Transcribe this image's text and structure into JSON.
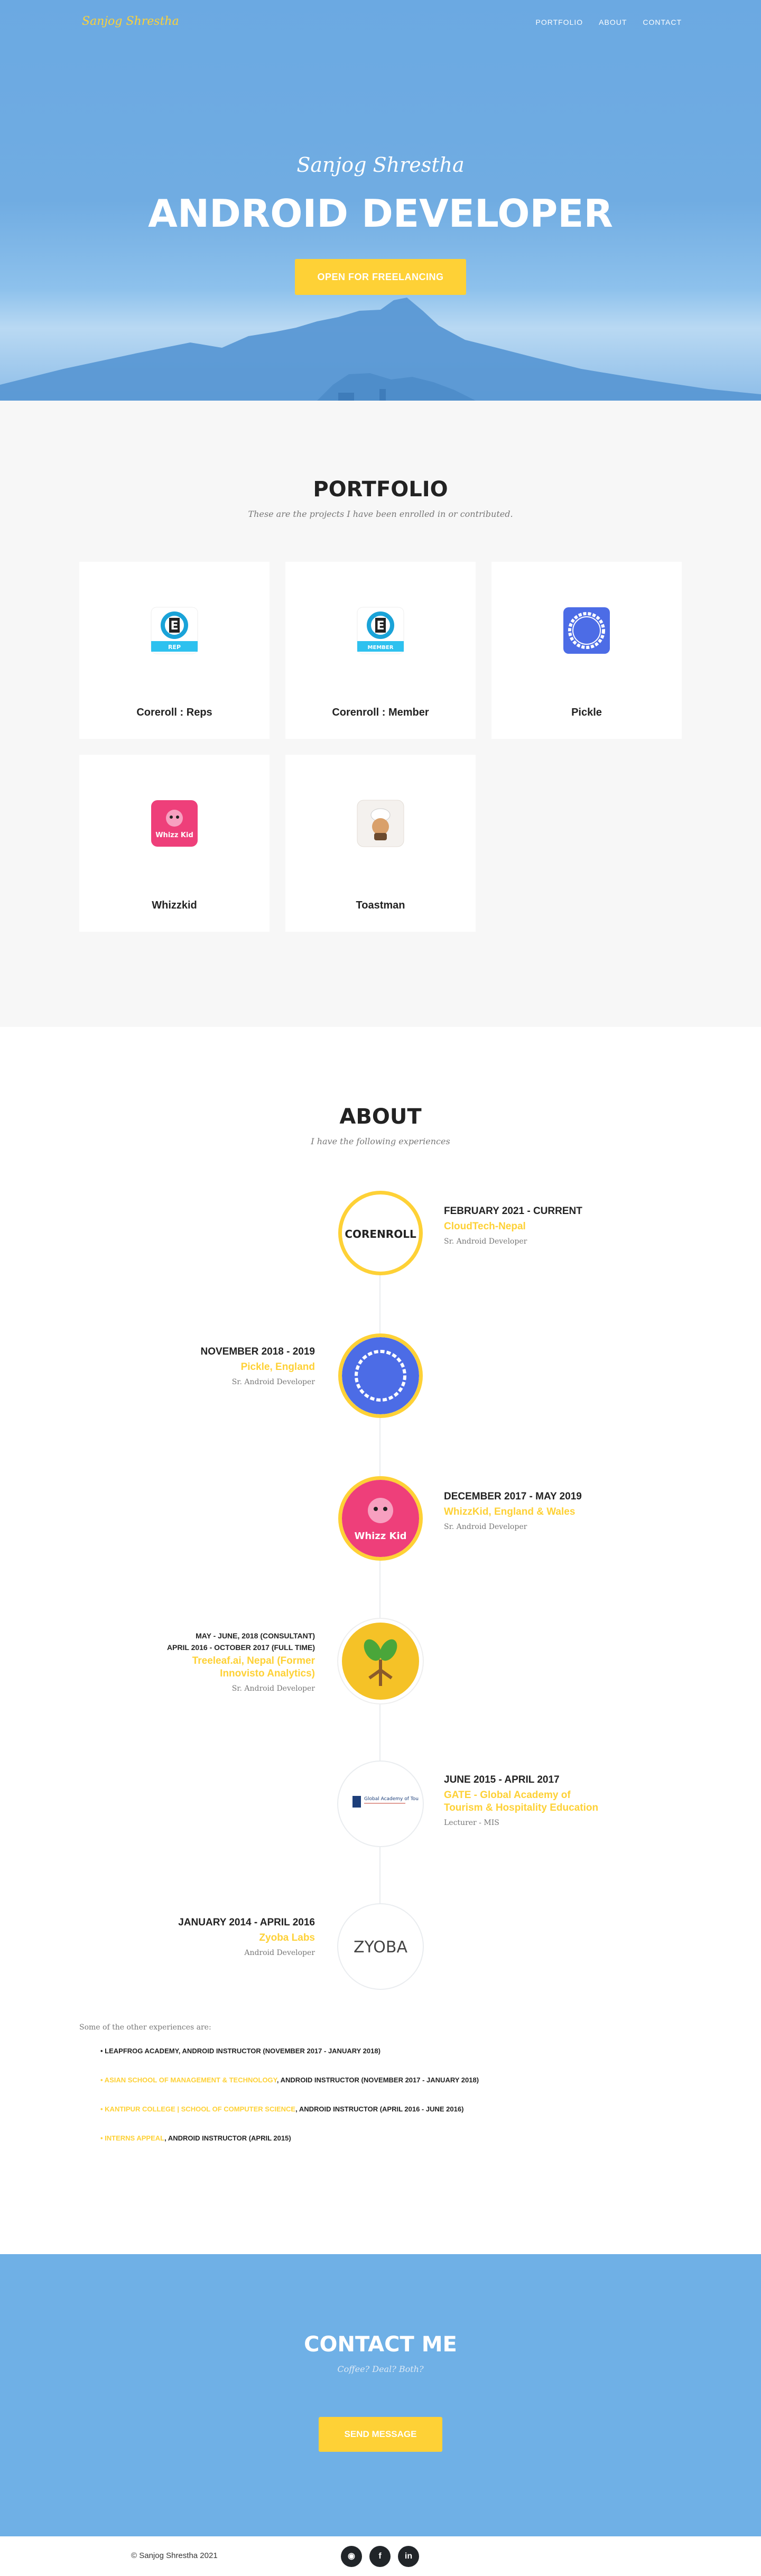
{
  "nav": {
    "brand": "Sanjog Shrestha",
    "links": [
      "PORTFOLIO",
      "ABOUT",
      "CONTACT"
    ]
  },
  "hero": {
    "intro": "Sanjog Shrestha",
    "title": "ANDROID DEVELOPER",
    "button": "OPEN FOR FREELANCING"
  },
  "portfolio": {
    "title": "PORTFOLIO",
    "subtitle": "These are the projects I have been enrolled in or contributed.",
    "items": [
      {
        "name": "Coreroll : Reps",
        "icon_label": "REP",
        "icon": "corenroll-rep-icon"
      },
      {
        "name": "Corenroll : Member",
        "icon_label": "MEMBER",
        "icon": "corenroll-member-icon"
      },
      {
        "name": "Pickle",
        "icon": "pickle-icon"
      },
      {
        "name": "Whizzkid",
        "icon_label": "Whizz Kid",
        "icon": "whizzkid-icon"
      },
      {
        "name": "Toastman",
        "icon": "toastman-icon"
      }
    ]
  },
  "about": {
    "title": "ABOUT",
    "subtitle": "I have the following experiences",
    "timeline": [
      {
        "date": "FEBRUARY 2021 - CURRENT",
        "org": "CloudTech-Nepal",
        "role": "Sr. Android Developer",
        "logo_text": "CORENROLL"
      },
      {
        "date": "NOVEMBER 2018 - 2019",
        "org": "Pickle, England",
        "role": "Sr. Android Developer"
      },
      {
        "date": "DECEMBER 2017 - MAY 2019",
        "org": "WhizzKid, England & Wales",
        "role": "Sr. Android Developer",
        "logo_text": "Whizz Kid"
      },
      {
        "date": "MAY - JUNE, 2018 (CONSULTANT)",
        "date2": "APRIL 2016 - OCTOBER 2017 (FULL TIME)",
        "org": "Treeleaf.ai, Nepal (Former Innovisto Analytics)",
        "role": "Sr. Android Developer"
      },
      {
        "date": "JUNE 2015 - APRIL 2017",
        "org": "GATE - Global Academy of Tourism & Hospitality Education",
        "role": "Lecturer - MIS",
        "logo_text": "Global Academy of Tourism & Hospitality Education"
      },
      {
        "date": "JANUARY 2014 - APRIL 2016",
        "org": "Zyoba Labs",
        "role": "Android Developer",
        "logo_text": "ZYOBA"
      }
    ],
    "other_intro": "Some of the other experiences are:",
    "other": [
      {
        "hl": "",
        "text": "• LEAPFROG ACADEMY, ANDROID INSTRUCTOR (NOVEMBER 2017 - JANUARY 2018)"
      },
      {
        "hl": "• ASIAN SCHOOL OF MANAGEMENT & TECHNOLOGY",
        "text": ", ANDROID INSTRUCTOR (NOVEMBER 2017 - JANUARY 2018)"
      },
      {
        "hl": "• KANTIPUR COLLEGE | SCHOOL OF COMPUTER SCIENCE",
        "text": ", ANDROID INSTRUCTOR (APRIL 2016 - JUNE 2016)"
      },
      {
        "hl": "• INTERNS APPEAL",
        "text": ", ANDROID INSTRUCTOR (APRIL 2015)"
      }
    ]
  },
  "contact": {
    "title": "CONTACT ME",
    "subtitle": "Coffee? Deal? Both?",
    "button": "SEND MESSAGE"
  },
  "footer": {
    "copyright": "© Sanjog Shrestha 2021",
    "social": [
      {
        "icon": "github-icon",
        "glyph": "◉"
      },
      {
        "icon": "facebook-icon",
        "glyph": "f"
      },
      {
        "icon": "linkedin-icon",
        "glyph": "in"
      }
    ]
  },
  "colors": {
    "accent": "#fed136",
    "hero_blue": "#6ca7de",
    "contact_blue": "#6fb0e6",
    "dark": "#212529"
  }
}
